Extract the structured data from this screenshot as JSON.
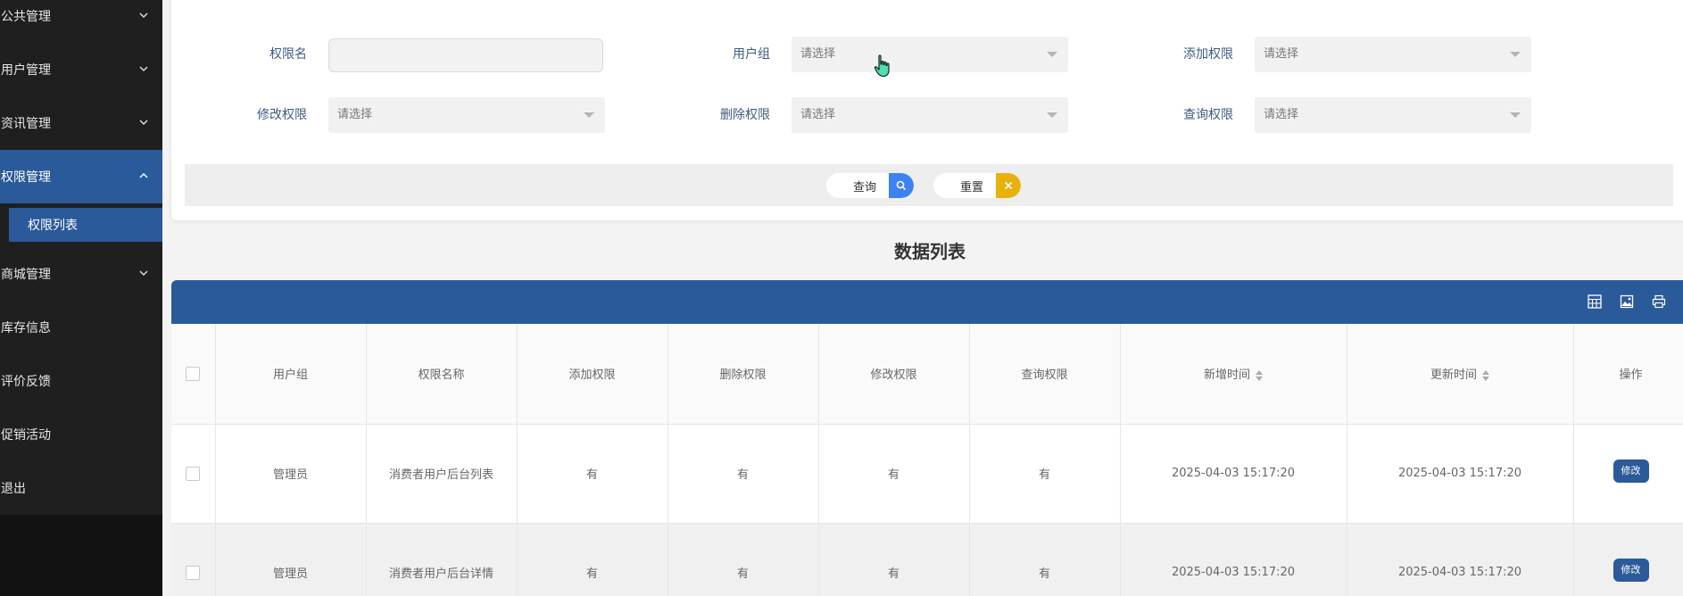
{
  "sidebar": {
    "items": [
      {
        "label": "公共管理",
        "has_arrow": true,
        "expanded": false
      },
      {
        "label": "用户管理",
        "has_arrow": true,
        "expanded": false
      },
      {
        "label": "资讯管理",
        "has_arrow": true,
        "expanded": false
      },
      {
        "label": "权限管理",
        "has_arrow": true,
        "expanded": true,
        "active": true
      },
      {
        "label": "商城管理",
        "has_arrow": true,
        "expanded": false
      },
      {
        "label": "库存信息",
        "has_arrow": false
      },
      {
        "label": "评价反馈",
        "has_arrow": false
      },
      {
        "label": "促销活动",
        "has_arrow": false
      },
      {
        "label": "退出",
        "has_arrow": false
      }
    ],
    "sub_item": "权限列表"
  },
  "filters": {
    "perm_name_label": "权限名",
    "perm_name_value": "",
    "user_group_label": "用户组",
    "user_group_placeholder": "请选择",
    "add_perm_label": "添加权限",
    "add_perm_placeholder": "请选择",
    "edit_perm_label": "修改权限",
    "edit_perm_placeholder": "请选择",
    "delete_perm_label": "删除权限",
    "delete_perm_placeholder": "请选择",
    "query_perm_label": "查询权限",
    "query_perm_placeholder": "请选择",
    "search_button": "查询",
    "reset_button": "重置"
  },
  "list_title": "数据列表",
  "table": {
    "headers": [
      "用户组",
      "权限名称",
      "添加权限",
      "删除权限",
      "修改权限",
      "查询权限",
      "新增时间",
      "更新时间",
      "操作"
    ],
    "rows": [
      {
        "group": "管理员",
        "name": "消费者用户后台列表",
        "add": "有",
        "del": "有",
        "edit": "有",
        "query": "有",
        "created": "2025-04-03 15:17:20",
        "updated": "2025-04-03 15:17:20",
        "action": "修改"
      },
      {
        "group": "管理员",
        "name": "消费者用户后台详情",
        "add": "有",
        "del": "有",
        "edit": "有",
        "query": "有",
        "created": "2025-04-03 15:17:20",
        "updated": "2025-04-03 15:17:20",
        "action": "修改"
      }
    ]
  },
  "colors": {
    "sidebar_bg": "#1f1f1f",
    "accent": "#2a5a9a",
    "search_icon_bg": "#3d82f2",
    "reset_icon_bg": "#e8b10c"
  },
  "icons": [
    "chevron-down-icon",
    "chevron-up-icon",
    "search-icon",
    "close-icon",
    "grid-icon",
    "export-image-icon",
    "print-icon",
    "hand-cursor-icon"
  ]
}
